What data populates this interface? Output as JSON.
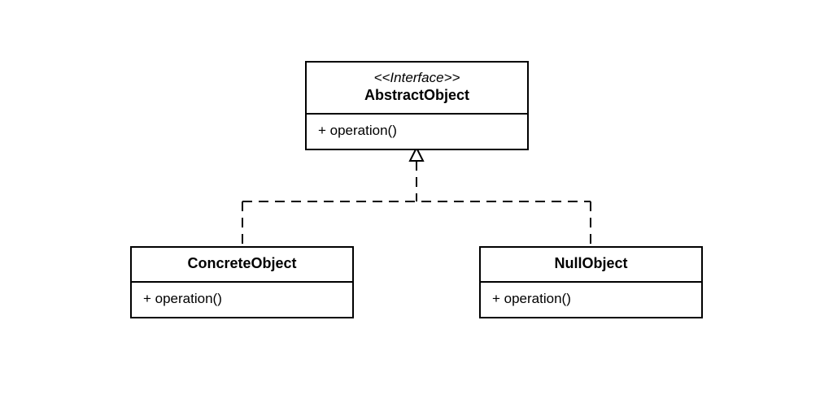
{
  "interface": {
    "stereotype": "<<Interface>>",
    "name": "AbstractObject",
    "operation": "+ operation()"
  },
  "concrete": {
    "name": "ConcreteObject",
    "operation": "+ operation()"
  },
  "nullobj": {
    "name": "NullObject",
    "operation": "+ operation()"
  }
}
